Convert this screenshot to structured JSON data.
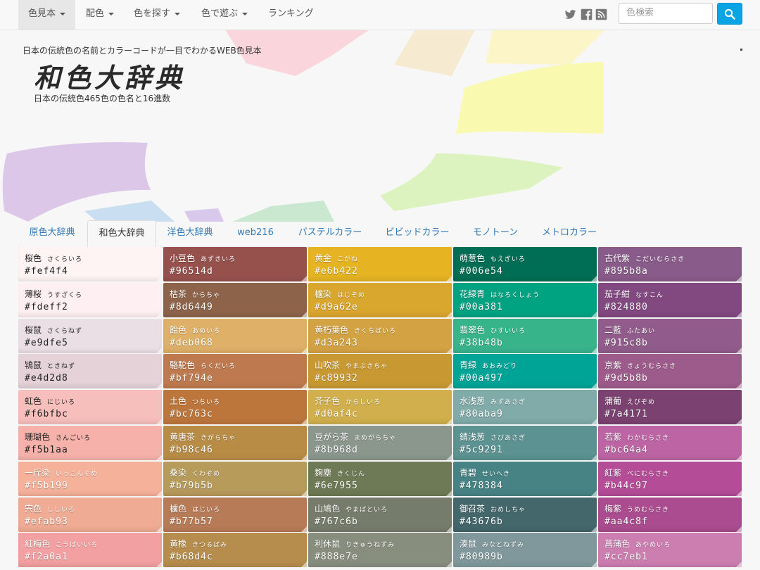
{
  "nav": {
    "items": [
      {
        "label": "色見本",
        "dropdown": true,
        "active": true
      },
      {
        "label": "配色",
        "dropdown": true,
        "active": false
      },
      {
        "label": "色を探す",
        "dropdown": true,
        "active": false
      },
      {
        "label": "色で遊ぶ",
        "dropdown": true,
        "active": false
      },
      {
        "label": "ランキング",
        "dropdown": false,
        "active": false
      }
    ],
    "social_icons": [
      "twitter-icon",
      "facebook-icon",
      "rss-icon"
    ],
    "search_placeholder": "色検索"
  },
  "header": {
    "tagline": "日本の伝統色の名前とカラーコードが一目でわかるWEB色見本",
    "logo": "和色大辞典",
    "subtitle": "日本の伝統色465色の色名と16進数"
  },
  "tabs": [
    {
      "label": "原色大辞典",
      "active": false
    },
    {
      "label": "和色大辞典",
      "active": true
    },
    {
      "label": "洋色大辞典",
      "active": false
    },
    {
      "label": "web216",
      "active": false
    },
    {
      "label": "パステルカラー",
      "active": false
    },
    {
      "label": "ビビッドカラー",
      "active": false
    },
    {
      "label": "モノトーン",
      "active": false
    },
    {
      "label": "メトロカラー",
      "active": false
    }
  ],
  "colors": [
    [
      {
        "name": "桜色",
        "reading": "さくらいろ",
        "hex": "#fef4f4"
      },
      {
        "name": "小豆色",
        "reading": "あずきいろ",
        "hex": "#96514d"
      },
      {
        "name": "黄金",
        "reading": "こがね",
        "hex": "#e6b422"
      },
      {
        "name": "萌葱色",
        "reading": "もえぎいろ",
        "hex": "#006e54"
      },
      {
        "name": "古代紫",
        "reading": "こだいむらさき",
        "hex": "#895b8a"
      }
    ],
    [
      {
        "name": "薄桜",
        "reading": "うすざくら",
        "hex": "#fdeff2"
      },
      {
        "name": "枯茶",
        "reading": "からちゃ",
        "hex": "#8d6449"
      },
      {
        "name": "櫨染",
        "reading": "はじぞめ",
        "hex": "#d9a62e"
      },
      {
        "name": "花緑青",
        "reading": "はなろくしょう",
        "hex": "#00a381"
      },
      {
        "name": "茄子紺",
        "reading": "なすこん",
        "hex": "#824880"
      }
    ],
    [
      {
        "name": "桜鼠",
        "reading": "さくらねず",
        "hex": "#e9dfe5"
      },
      {
        "name": "飴色",
        "reading": "あめいろ",
        "hex": "#deb068"
      },
      {
        "name": "黄朽葉色",
        "reading": "きくちばいろ",
        "hex": "#d3a243"
      },
      {
        "name": "翡翠色",
        "reading": "ひすいいろ",
        "hex": "#38b48b"
      },
      {
        "name": "二藍",
        "reading": "ふたあい",
        "hex": "#915c8b"
      }
    ],
    [
      {
        "name": "鴇鼠",
        "reading": "ときねず",
        "hex": "#e4d2d8"
      },
      {
        "name": "駱駝色",
        "reading": "らくだいろ",
        "hex": "#bf794e"
      },
      {
        "name": "山吹茶",
        "reading": "やまぶきちゃ",
        "hex": "#c89932"
      },
      {
        "name": "青緑",
        "reading": "あおみどり",
        "hex": "#00a497"
      },
      {
        "name": "京紫",
        "reading": "きょうむらさき",
        "hex": "#9d5b8b"
      }
    ],
    [
      {
        "name": "虹色",
        "reading": "にじいろ",
        "hex": "#f6bfbc"
      },
      {
        "name": "土色",
        "reading": "つちいろ",
        "hex": "#bc763c"
      },
      {
        "name": "芥子色",
        "reading": "からしいろ",
        "hex": "#d0af4c"
      },
      {
        "name": "水浅葱",
        "reading": "みずあさぎ",
        "hex": "#80aba9"
      },
      {
        "name": "蒲葡",
        "reading": "えびぞめ",
        "hex": "#7a4171"
      }
    ],
    [
      {
        "name": "珊瑚色",
        "reading": "さんごいろ",
        "hex": "#f5b1aa"
      },
      {
        "name": "黄唐茶",
        "reading": "きがらちゃ",
        "hex": "#b98c46"
      },
      {
        "name": "豆がら茶",
        "reading": "まめがらちゃ",
        "hex": "#8b968d"
      },
      {
        "name": "錆浅葱",
        "reading": "さびあさぎ",
        "hex": "#5c9291"
      },
      {
        "name": "若紫",
        "reading": "わかむらさき",
        "hex": "#bc64a4"
      }
    ],
    [
      {
        "name": "一斤染",
        "reading": "いっこんぞめ",
        "hex": "#f5b199"
      },
      {
        "name": "桑染",
        "reading": "くわぞめ",
        "hex": "#b79b5b"
      },
      {
        "name": "麹塵",
        "reading": "きくじん",
        "hex": "#6e7955"
      },
      {
        "name": "青碧",
        "reading": "せいへき",
        "hex": "#478384"
      },
      {
        "name": "紅紫",
        "reading": "べにむらさき",
        "hex": "#b44c97"
      }
    ],
    [
      {
        "name": "宍色",
        "reading": "ししいろ",
        "hex": "#efab93"
      },
      {
        "name": "櫨色",
        "reading": "はじいろ",
        "hex": "#b77b57"
      },
      {
        "name": "山鳩色",
        "reading": "やまばといろ",
        "hex": "#767c6b"
      },
      {
        "name": "御召茶",
        "reading": "おめしちゃ",
        "hex": "#43676b"
      },
      {
        "name": "梅紫",
        "reading": "うめむらさき",
        "hex": "#aa4c8f"
      }
    ],
    [
      {
        "name": "紅梅色",
        "reading": "こうばいいろ",
        "hex": "#f2a0a1"
      },
      {
        "name": "黄橡",
        "reading": "きつるばみ",
        "hex": "#b68d4c"
      },
      {
        "name": "利休鼠",
        "reading": "りきゅうねずみ",
        "hex": "#888e7e"
      },
      {
        "name": "湊鼠",
        "reading": "みなとねずみ",
        "hex": "#80989b"
      },
      {
        "name": "菖蒲色",
        "reading": "あやめいろ",
        "hex": "#cc7eb1"
      }
    ]
  ]
}
